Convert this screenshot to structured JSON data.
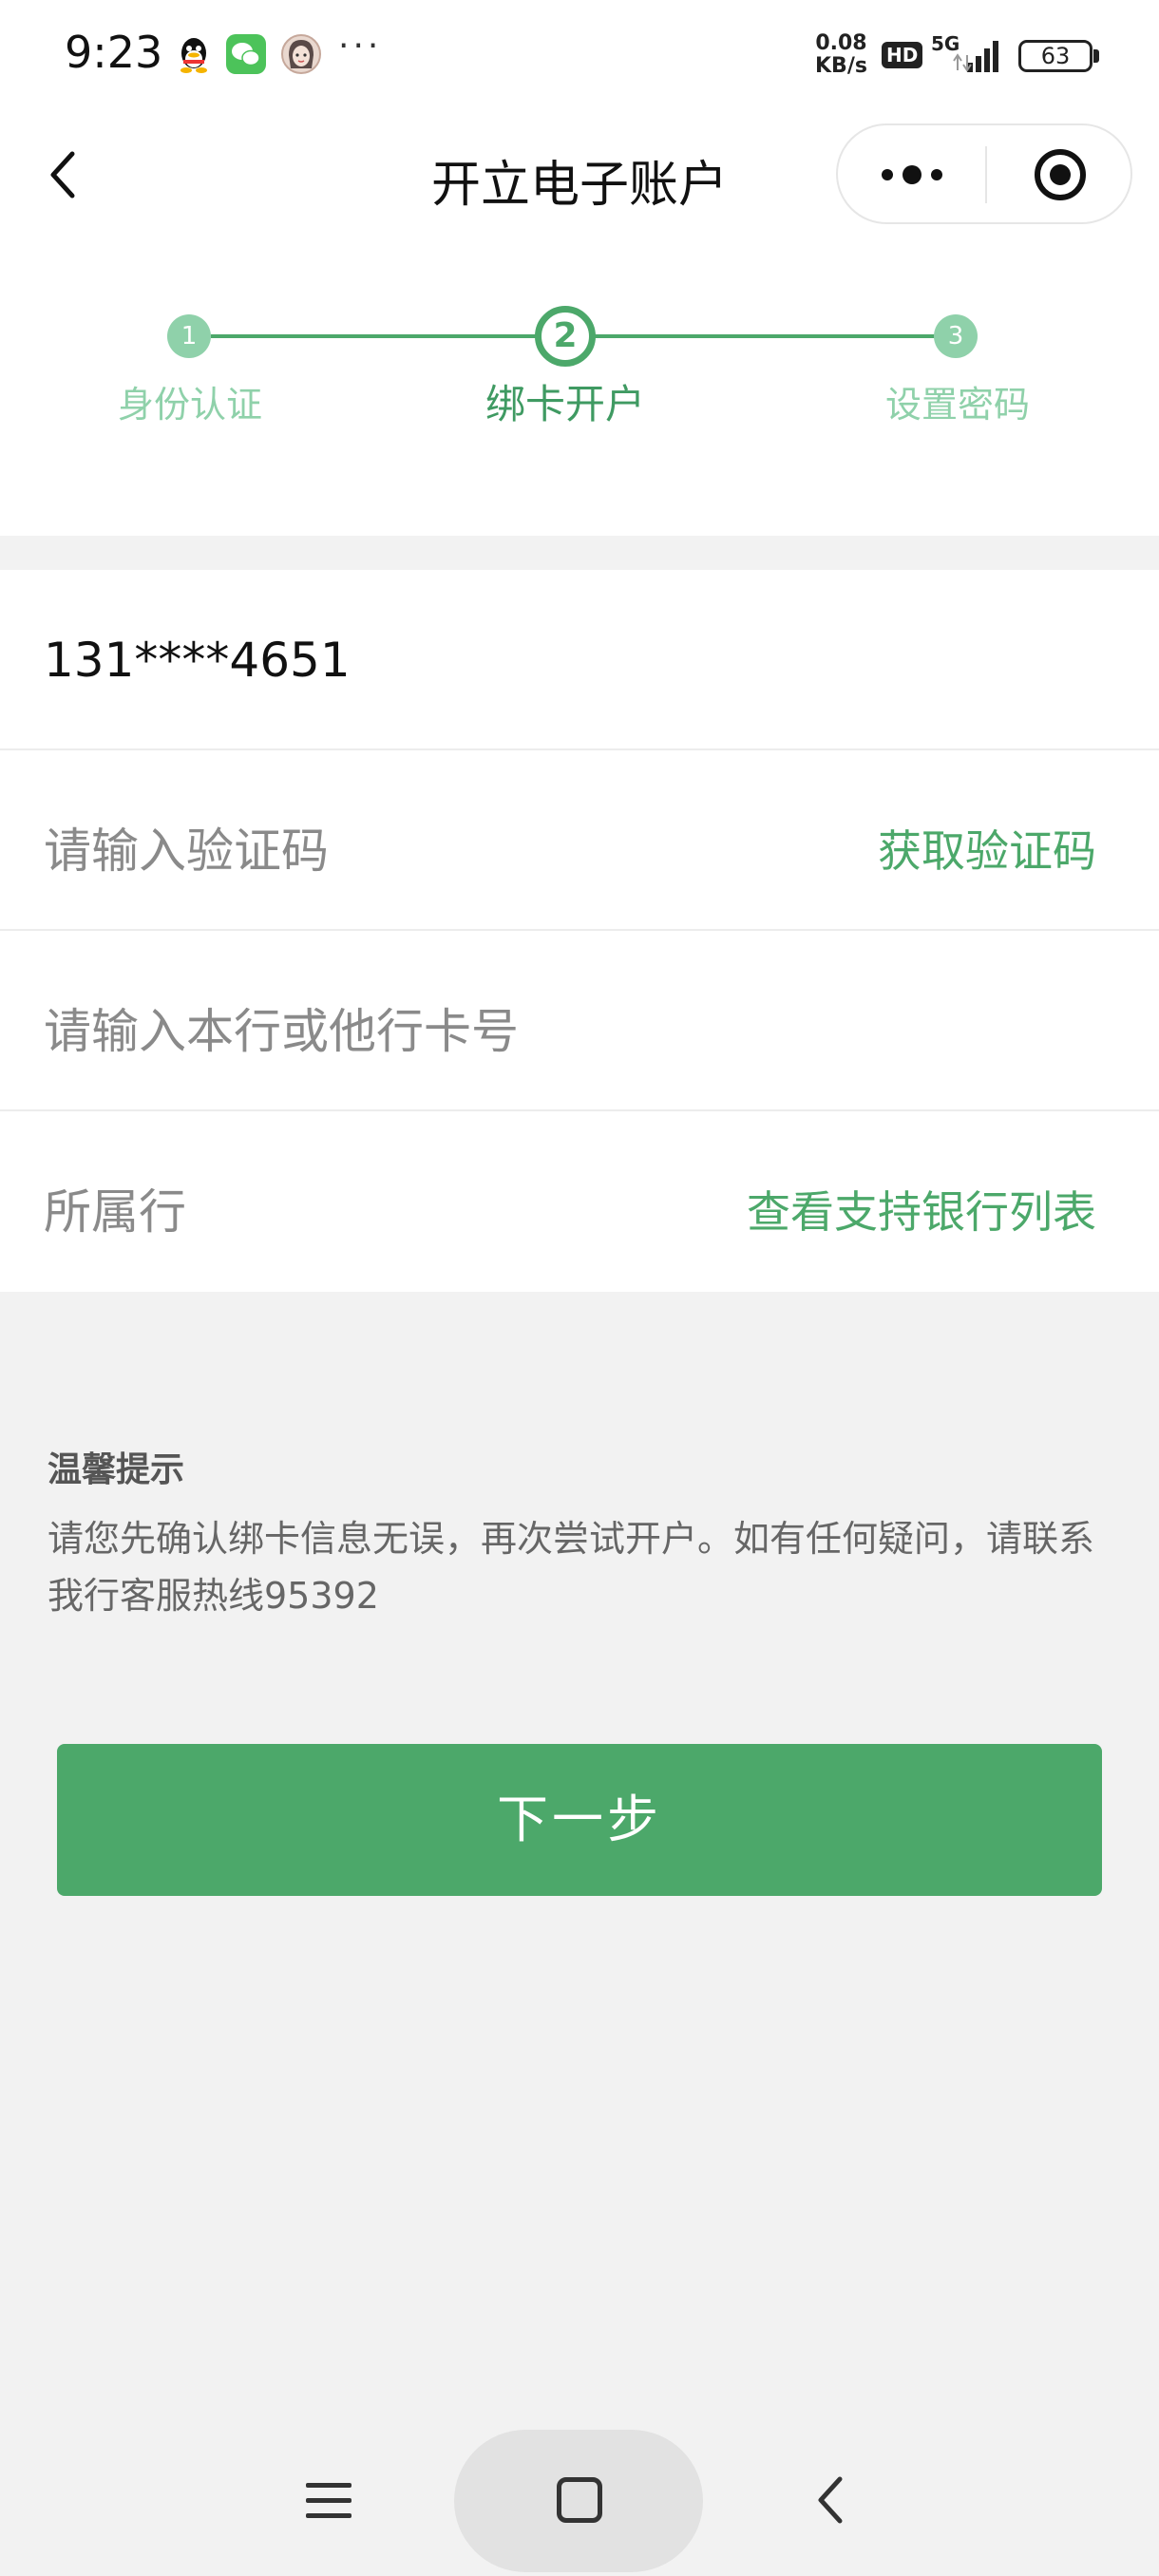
{
  "status_bar": {
    "time": "9:23",
    "more": "···",
    "net_speed_value": "0.08",
    "net_speed_unit": "KB/s",
    "hd": "HD",
    "network": "5G",
    "battery": "63"
  },
  "header": {
    "title": "开立电子账户",
    "back_icon": "chevron-left-icon",
    "more_icon": "more-dots-icon",
    "close_icon": "target-circle-icon"
  },
  "stepper": {
    "current_step": 2,
    "steps": [
      {
        "number": "1",
        "label": "身份认证"
      },
      {
        "number": "2",
        "label": "绑卡开户"
      },
      {
        "number": "3",
        "label": "设置密码"
      }
    ]
  },
  "form": {
    "phone_value": "131****4651",
    "code_placeholder": "请输入验证码",
    "get_code_label": "获取验证码",
    "card_placeholder": "请输入本行或他行卡号",
    "bank_label": "所属行",
    "bank_list_label": "查看支持银行列表"
  },
  "tip": {
    "title": "温馨提示",
    "text": "请您先确认绑卡信息无误，再次尝试开户。如有任何疑问，请联系我行客服热线95392"
  },
  "next_button_label": "下一步",
  "colors": {
    "accent": "#4ca86a",
    "accent_light": "#8fd1aa",
    "background": "#f2f2f2",
    "placeholder": "#8a8a8a"
  }
}
